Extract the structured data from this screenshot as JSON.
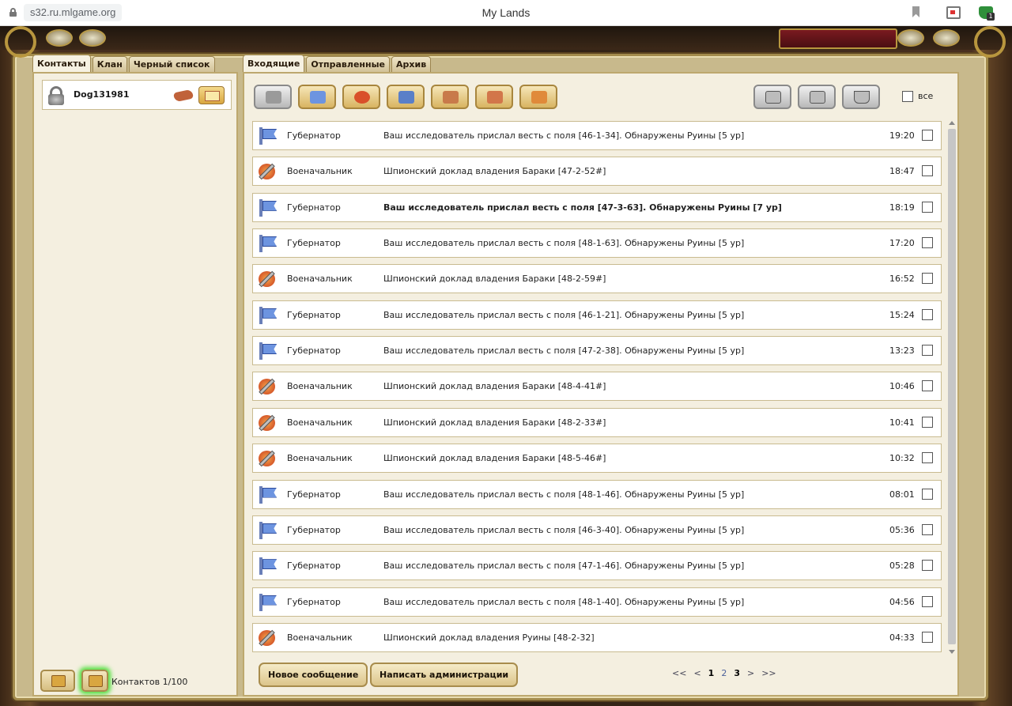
{
  "browser": {
    "url": "s32.ru.mlgame.org",
    "title": "My Lands"
  },
  "left": {
    "tabs": [
      "Контакты",
      "Клан",
      "Черный список"
    ],
    "contact": {
      "name": "Dog131981"
    },
    "count_label": "Контактов 1/100"
  },
  "right": {
    "tabs": [
      "Входящие",
      "Отправленные",
      "Архив"
    ],
    "select_all_label": "все",
    "messages": [
      {
        "type": "gov",
        "sender": "Губернатор",
        "subject": "Ваш исследователь прислал весть с поля [46-1-34]. Обнаружены Руины [5 ур]",
        "time": "19:20",
        "unread": false
      },
      {
        "type": "war",
        "sender": "Военачальник",
        "subject": "Шпионский доклад владения Бараки [47-2-52#]",
        "time": "18:47",
        "unread": false
      },
      {
        "type": "gov",
        "sender": "Губернатор",
        "subject": "Ваш исследователь прислал весть с поля [47-3-63]. Обнаружены Руины [7 ур]",
        "time": "18:19",
        "unread": true
      },
      {
        "type": "gov",
        "sender": "Губернатор",
        "subject": "Ваш исследователь прислал весть с поля [48-1-63]. Обнаружены Руины [5 ур]",
        "time": "17:20",
        "unread": false
      },
      {
        "type": "war",
        "sender": "Военачальник",
        "subject": "Шпионский доклад владения Бараки [48-2-59#]",
        "time": "16:52",
        "unread": false
      },
      {
        "type": "gov",
        "sender": "Губернатор",
        "subject": "Ваш исследователь прислал весть с поля [46-1-21]. Обнаружены Руины [5 ур]",
        "time": "15:24",
        "unread": false
      },
      {
        "type": "gov",
        "sender": "Губернатор",
        "subject": "Ваш исследователь прислал весть с поля [47-2-38]. Обнаружены Руины [5 ур]",
        "time": "13:23",
        "unread": false
      },
      {
        "type": "war",
        "sender": "Военачальник",
        "subject": "Шпионский доклад владения Бараки [48-4-41#]",
        "time": "10:46",
        "unread": false
      },
      {
        "type": "war",
        "sender": "Военачальник",
        "subject": "Шпионский доклад владения Бараки [48-2-33#]",
        "time": "10:41",
        "unread": false
      },
      {
        "type": "war",
        "sender": "Военачальник",
        "subject": "Шпионский доклад владения Бараки [48-5-46#]",
        "time": "10:32",
        "unread": false
      },
      {
        "type": "gov",
        "sender": "Губернатор",
        "subject": "Ваш исследователь прислал весть с поля [48-1-46]. Обнаружены Руины [5 ур]",
        "time": "08:01",
        "unread": false
      },
      {
        "type": "gov",
        "sender": "Губернатор",
        "subject": "Ваш исследователь прислал весть с поля [46-3-40]. Обнаружены Руины [5 ур]",
        "time": "05:36",
        "unread": false
      },
      {
        "type": "gov",
        "sender": "Губернатор",
        "subject": "Ваш исследователь прислал весть с поля [47-1-46]. Обнаружены Руины [5 ур]",
        "time": "05:28",
        "unread": false
      },
      {
        "type": "gov",
        "sender": "Губернатор",
        "subject": "Ваш исследователь прислал весть с поля [48-1-40]. Обнаружены Руины [5 ур]",
        "time": "04:56",
        "unread": false
      },
      {
        "type": "war",
        "sender": "Военачальник",
        "subject": "Шпионский доклад владения Руины [48-2-32]",
        "time": "04:33",
        "unread": false
      }
    ],
    "new_message_label": "Новое сообщение",
    "write_admin_label": "Написать администрации",
    "pager": {
      "first": "<<",
      "prev": "<",
      "pages": [
        "1",
        "2",
        "3"
      ],
      "current": "1",
      "next": ">",
      "last": ">>"
    }
  },
  "colors": {
    "frame_gold": "#b8963e",
    "panel_bg": "#f4efe0",
    "button_gold": "#d8b461"
  },
  "icons": {
    "toolbar_filters": [
      "scroll-icon",
      "governor-flag-icon",
      "warlord-shield-icon",
      "book-icon",
      "people-icon",
      "handshake-icon",
      "king-icon"
    ],
    "toolbar_actions": [
      "envelope-icon",
      "archive-box-icon",
      "trash-icon"
    ]
  }
}
